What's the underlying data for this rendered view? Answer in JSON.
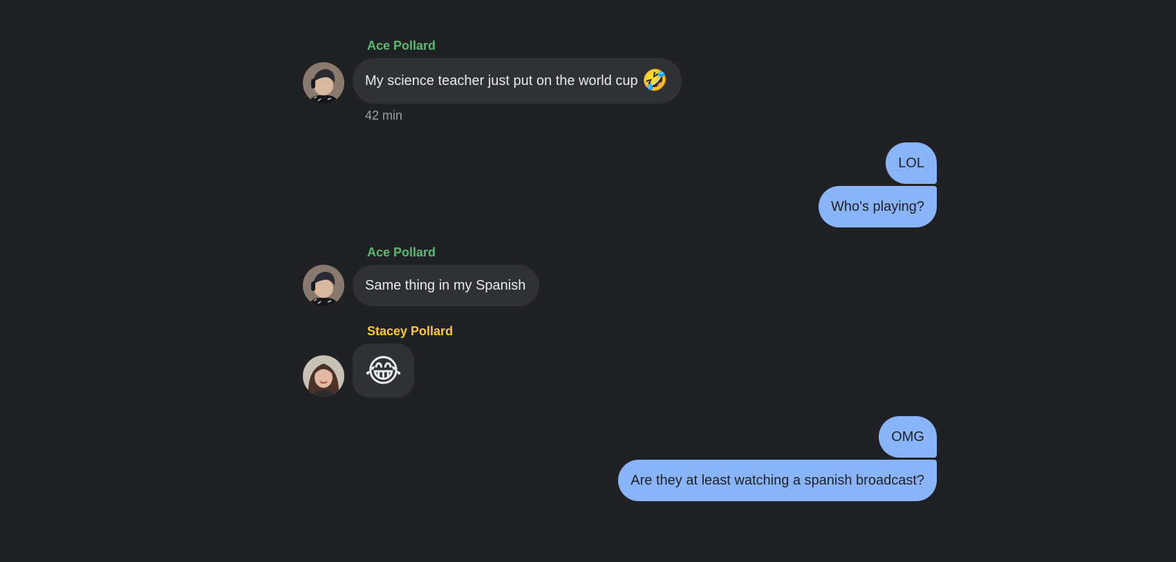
{
  "messages": [
    {
      "sender": "Ace Pollard",
      "text": "My science teacher just put on the world cup",
      "emoji": "🤣",
      "time": "42 min"
    },
    {
      "outgoing": [
        "LOL",
        "Who's playing?"
      ]
    },
    {
      "sender": "Ace Pollard",
      "text": "Same thing in my Spanish"
    },
    {
      "sender": "Stacey Pollard",
      "emoji": "😂"
    },
    {
      "outgoing": [
        "OMG",
        "Are they at least watching a spanish broadcast?"
      ]
    }
  ],
  "colors": {
    "background": "#202124",
    "incoming_bubble": "#303134",
    "outgoing_bubble": "#8ab4f8",
    "ace_name": "#5bb974",
    "stacey_name": "#fcc934"
  }
}
